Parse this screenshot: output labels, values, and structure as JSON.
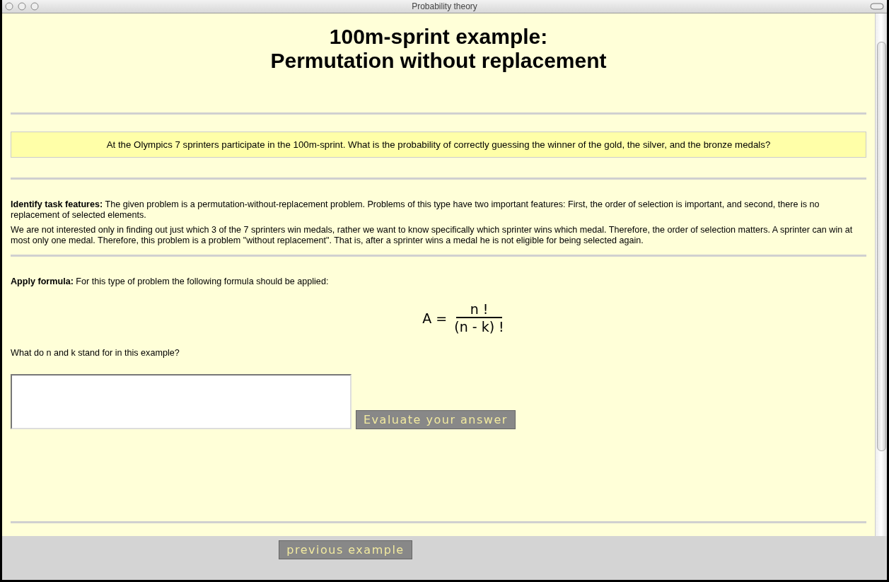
{
  "window": {
    "title": "Probability theory"
  },
  "heading": [
    "100m-sprint example:",
    "Permutation without replacement"
  ],
  "problem": "At the Olympics 7 sprinters participate in the 100m-sprint. What is the probability of correctly guessing the winner of the gold, the silver, and the bronze medals?",
  "features": [
    "**Identify task features:** The given problem is a permutation-without-replacement problem. Problems of this type have two important features: First, the order of selection is important, and second, there is no replacement of selected elements.",
    "We are not interested only in finding out just which 3 of the 7 sprinters win medals, rather we want to know specifically which sprinter wins which medal. Therefore, the order of selection matters. A sprinter can win at most only one medal. Therefore, this problem is a problem \"without replacement\". That is, after a sprinter wins a medal he is not eligible for being selected again."
  ],
  "apply": "**Apply formula:** For this type of problem the following formula should be applied:",
  "formula": {
    "lhs": "A =",
    "numerator": "n !",
    "denominator": "(n - k) !"
  },
  "question": "What do n and k stand for in this example?",
  "evaluate_button": "Evaluate your answer",
  "previous_button": "previous example"
}
